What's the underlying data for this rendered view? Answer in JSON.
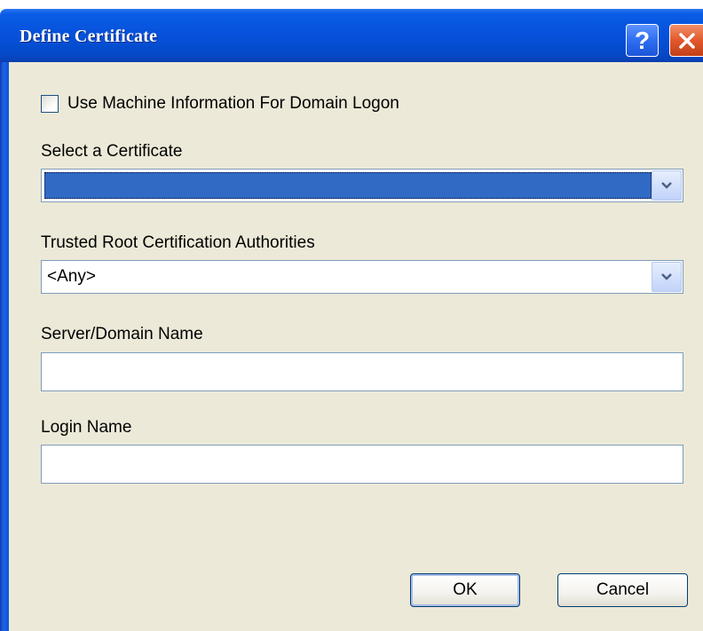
{
  "dialog": {
    "title": "Define Certificate",
    "help_glyph": "?",
    "close_icon": "close-icon"
  },
  "options": {
    "use_machine_info_label": "Use Machine Information For Domain Logon",
    "use_machine_info_checked": false
  },
  "certificate": {
    "label": "Select a Certificate",
    "value": "",
    "selected_highlight_color": "#316ac5"
  },
  "trusted_root": {
    "label": "Trusted Root Certification Authorities",
    "value": "<Any>"
  },
  "server": {
    "label": "Server/Domain Name",
    "value": ""
  },
  "login": {
    "label": "Login Name",
    "value": ""
  },
  "buttons": {
    "ok": "OK",
    "cancel": "Cancel"
  },
  "colors": {
    "titlebar": "#0550d6",
    "client_bg": "#ece9d8",
    "field_border": "#7f9db9",
    "close_button": "#e2582c"
  }
}
